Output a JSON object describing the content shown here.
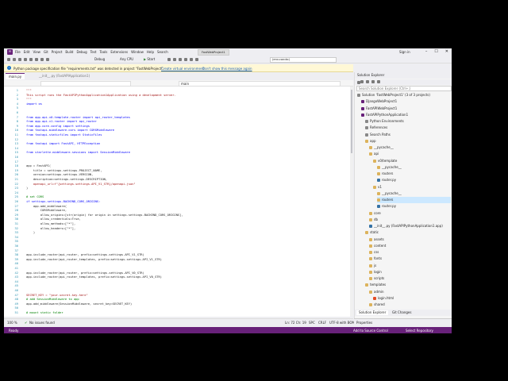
{
  "titlebar": {
    "menu": [
      "File",
      "Edit",
      "View",
      "Git",
      "Project",
      "Build",
      "Debug",
      "Test",
      "Tools",
      "Extensions",
      "Window",
      "Help",
      "Search"
    ],
    "solution_badge": "FastWebProject1",
    "sign_in": "Sign in",
    "controls": [
      "–",
      "☐",
      "✕"
    ]
  },
  "toolbar": {
    "config": "Debug",
    "platform": "Any CPU",
    "start": "Start",
    "search_combo": "(env.conda:)"
  },
  "infobar": {
    "message": "Python package specification file \"requirements.txt\" was detected in project \"FastWebProject\".",
    "link1": "Create virtual environment",
    "link2": "Don't show this message again"
  },
  "tabs": [
    {
      "label": "main.py"
    },
    {
      "label": "__init__.py  (FastAPIApplication1)"
    }
  ],
  "navbar": {
    "left": "",
    "right": "main"
  },
  "code": [
    {
      "n": "1",
      "t": "\"\"\"",
      "c": "dc"
    },
    {
      "n": "2",
      "t": "This script runs the FastAPIPythonApplication1Application using a development server.",
      "c": "dc"
    },
    {
      "n": "3",
      "t": "\"\"\"",
      "c": "dc"
    },
    {
      "n": "4",
      "t": "import os",
      "c": "kw"
    },
    {
      "n": "5",
      "t": "",
      "c": "id"
    },
    {
      "n": "6",
      "t": "",
      "c": "id"
    },
    {
      "n": "7",
      "t": "from app.api.v0.template.router import api_router_templates",
      "c": "kw"
    },
    {
      "n": "8",
      "t": "from app.api.v1.router import api_router",
      "c": "kw"
    },
    {
      "n": "9",
      "t": "from app.core.config import settings",
      "c": "kw"
    },
    {
      "n": "10",
      "t": "from fastapi.middleware.cors import CORSMiddleware",
      "c": "kw"
    },
    {
      "n": "11",
      "t": "from fastapi.staticfiles import StaticFiles",
      "c": "kw"
    },
    {
      "n": "12",
      "t": "",
      "c": "id"
    },
    {
      "n": "13",
      "t": "from fastapi import FastAPI, HTTPException",
      "c": "kw"
    },
    {
      "n": "14",
      "t": "",
      "c": "id"
    },
    {
      "n": "15",
      "t": "from starlette.middleware.sessions import SessionMiddleware",
      "c": "kw"
    },
    {
      "n": "16",
      "t": "",
      "c": "id"
    },
    {
      "n": "17",
      "t": "",
      "c": "id"
    },
    {
      "n": "18",
      "t": "app = FastAPI(",
      "c": "id"
    },
    {
      "n": "19",
      "t": "    title = settings.settings.PROJECT_NAME,",
      "c": "id"
    },
    {
      "n": "20",
      "t": "    version=settings.settings.VERSION,",
      "c": "id"
    },
    {
      "n": "21",
      "t": "    description=settings.settings.DESCRIPTION,",
      "c": "id"
    },
    {
      "n": "22",
      "t": "    openapi_url=f\"{settings.settings.API_V1_STR}/openapi.json\"",
      "c": "st"
    },
    {
      "n": "23",
      "t": ")",
      "c": "id"
    },
    {
      "n": "24",
      "t": "",
      "c": "id"
    },
    {
      "n": "25",
      "t": "# set CORS",
      "c": "cm"
    },
    {
      "n": "26",
      "t": "if settings.settings.BACKEND_CORS_ORIGINS:",
      "c": "kw"
    },
    {
      "n": "27",
      "t": "    app.add_middleware(",
      "c": "id"
    },
    {
      "n": "28",
      "t": "        CORSMiddleware,",
      "c": "id"
    },
    {
      "n": "29",
      "t": "        allow_origins=[str(origin) for origin in settings.settings.BACKEND_CORS_ORIGINS],",
      "c": "id"
    },
    {
      "n": "30",
      "t": "        allow_credentials=True,",
      "c": "id"
    },
    {
      "n": "31",
      "t": "        allow_methods=[\"*\"],",
      "c": "id"
    },
    {
      "n": "32",
      "t": "        allow_headers=[\"*\"],",
      "c": "id"
    },
    {
      "n": "33",
      "t": "    )",
      "c": "id"
    },
    {
      "n": "34",
      "t": "",
      "c": "id"
    },
    {
      "n": "35",
      "t": "",
      "c": "id"
    },
    {
      "n": "36",
      "t": "",
      "c": "id"
    },
    {
      "n": "37",
      "t": "",
      "c": "id"
    },
    {
      "n": "38",
      "t": "app.include_router(api_router, prefix=settings.settings.API_V1_STR)",
      "c": "id"
    },
    {
      "n": "39",
      "t": "app.include_router(api_router_templates, prefix=settings.settings.API_V1_STR)",
      "c": "id"
    },
    {
      "n": "40",
      "t": "",
      "c": "id"
    },
    {
      "n": "41",
      "t": "",
      "c": "id"
    },
    {
      "n": "42",
      "t": "app.include_router(api_router, prefix=settings.settings.API_V0_STR)",
      "c": "id"
    },
    {
      "n": "43",
      "t": "app.include_router(api_router_templates, prefix=settings.settings.API_V0_STR)",
      "c": "id"
    },
    {
      "n": "44",
      "t": "",
      "c": "id"
    },
    {
      "n": "45",
      "t": "",
      "c": "id"
    },
    {
      "n": "46",
      "t": "",
      "c": "id"
    },
    {
      "n": "47",
      "t": "SECRET_KEY = \"your-secret-key-here\"",
      "c": "st"
    },
    {
      "n": "48",
      "t": "# add SessionMiddleware to app",
      "c": "cm"
    },
    {
      "n": "49",
      "t": "app.add_middleware(SessionMiddleware, secret_key=SECRET_KEY)",
      "c": "id"
    },
    {
      "n": "50",
      "t": "",
      "c": "id"
    },
    {
      "n": "51",
      "t": "# mount static folder",
      "c": "cm"
    }
  ],
  "editor_status": {
    "zoom": "100 %",
    "issues": "No issues found",
    "position": "Ln: 72  Ch: 19",
    "spc": "SPC",
    "crlf": "CRLF",
    "encoding": "UTF-8 with BOM"
  },
  "bottom_status": {
    "ready": "Ready",
    "source_control": "Add to Source Control",
    "repo": "Select Repository"
  },
  "explorer": {
    "title": "Solution Explorer",
    "search_placeholder": "Search Solution Explorer (Ctrl+;)",
    "nodes": [
      {
        "label": "Solution 'FastWebProject1' (3 of 3 projects)",
        "indent": 0,
        "icon": "gr"
      },
      {
        "label": "DjangoWebProject1",
        "indent": 1,
        "icon": "pr"
      },
      {
        "label": "FastAPIWebProject1",
        "indent": 1,
        "icon": "pr"
      },
      {
        "label": "FastAPIPythonApplication1",
        "indent": 1,
        "icon": "pr"
      },
      {
        "label": "Python Environments",
        "indent": 2,
        "icon": "gr"
      },
      {
        "label": "References",
        "indent": 2,
        "icon": "gr"
      },
      {
        "label": "Search Paths",
        "indent": 2,
        "icon": "gr"
      },
      {
        "label": "app",
        "indent": 2,
        "icon": "f"
      },
      {
        "label": "__pycache__",
        "indent": 3,
        "icon": "f"
      },
      {
        "label": "api",
        "indent": 3,
        "icon": "f"
      },
      {
        "label": "v0/template",
        "indent": 4,
        "icon": "f"
      },
      {
        "label": "__pycache__",
        "indent": 5,
        "icon": "f"
      },
      {
        "label": "routers",
        "indent": 5,
        "icon": "f"
      },
      {
        "label": "router.py",
        "indent": 5,
        "icon": "py"
      },
      {
        "label": "v1",
        "indent": 4,
        "icon": "f"
      },
      {
        "label": "__pycache__",
        "indent": 5,
        "icon": "f"
      },
      {
        "label": "routers",
        "indent": 5,
        "icon": "f",
        "sel": true
      },
      {
        "label": "router.py",
        "indent": 5,
        "icon": "py"
      },
      {
        "label": "core",
        "indent": 3,
        "icon": "f"
      },
      {
        "label": "db",
        "indent": 3,
        "icon": "f"
      },
      {
        "label": "__init__.py (FastAPIPythonApplication1.app)",
        "indent": 3,
        "icon": "py"
      },
      {
        "label": "static",
        "indent": 2,
        "icon": "f"
      },
      {
        "label": "assets",
        "indent": 3,
        "icon": "f"
      },
      {
        "label": "content",
        "indent": 3,
        "icon": "f"
      },
      {
        "label": "css",
        "indent": 3,
        "icon": "f"
      },
      {
        "label": "fonts",
        "indent": 3,
        "icon": "f"
      },
      {
        "label": "js",
        "indent": 3,
        "icon": "f"
      },
      {
        "label": "login",
        "indent": 3,
        "icon": "f"
      },
      {
        "label": "scripts",
        "indent": 3,
        "icon": "f"
      },
      {
        "label": "templates",
        "indent": 2,
        "icon": "f"
      },
      {
        "label": "admin",
        "indent": 3,
        "icon": "f"
      },
      {
        "label": "login.html",
        "indent": 4,
        "icon": "ht"
      },
      {
        "label": "shared",
        "indent": 3,
        "icon": "f"
      }
    ],
    "tabs": [
      "Solution Explorer",
      "Git Changes"
    ]
  },
  "properties": {
    "title": "Properties"
  }
}
